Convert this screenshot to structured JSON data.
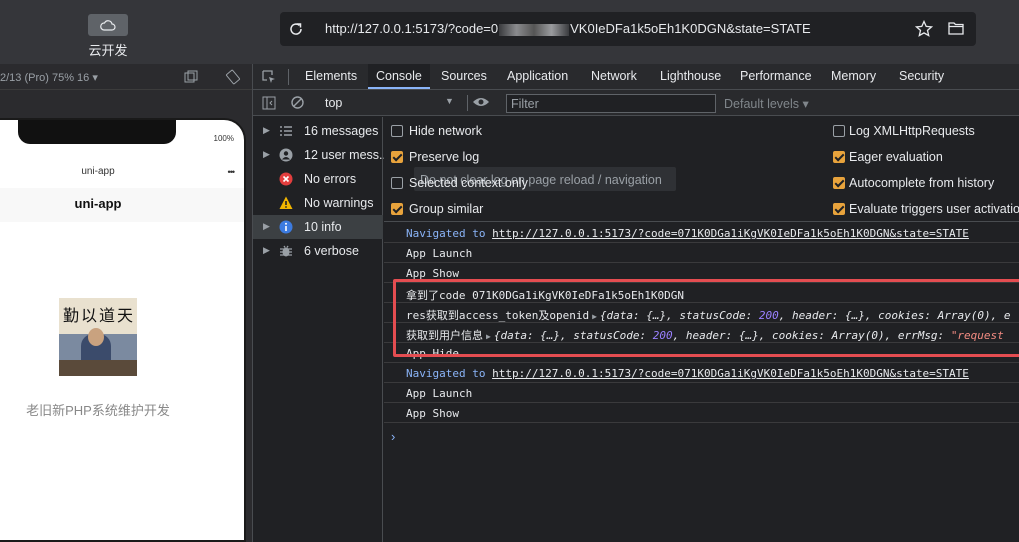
{
  "topbar": {
    "cloud_label": "云开发",
    "url_prefix": "http://127.0.0.1:5173/?code=0",
    "url_suffix": "VK0IeDFa1k5oEh1K0DGN&state=STATE"
  },
  "device": {
    "label": "2/13 (Pro) 75% 16 ▾",
    "battery": "100%",
    "status_title": "uni-app",
    "nav_title": "uni-app",
    "avatar_calligraphy": "勤以道天",
    "caption": "老旧新PHP系统维护开发"
  },
  "devtools": {
    "tabs": [
      "Elements",
      "Console",
      "Sources",
      "Application",
      "Network",
      "Lighthouse",
      "Performance",
      "Memory",
      "Security"
    ],
    "active_tab": "Console",
    "toolbar": {
      "context": "top",
      "filter_placeholder": "Filter",
      "levels": "Default levels ▾"
    },
    "sidebar": [
      {
        "label": "16 messages",
        "icon": "list-icon",
        "color": "#9aa0a6"
      },
      {
        "label": "12 user mess...",
        "icon": "user-icon",
        "color": "#9aa0a6"
      },
      {
        "label": "No errors",
        "icon": "error-icon",
        "color": "#e33e3e"
      },
      {
        "label": "No warnings",
        "icon": "warning-icon",
        "color": "#f2b600"
      },
      {
        "label": "10 info",
        "icon": "info-icon",
        "color": "#3c7be0"
      },
      {
        "label": "6 verbose",
        "icon": "bug-icon",
        "color": "#9aa0a6"
      }
    ],
    "settings": {
      "left": [
        {
          "label": "Hide network",
          "checked": false
        },
        {
          "label": "Preserve log",
          "checked": true
        },
        {
          "label": "Selected context only",
          "checked": false
        },
        {
          "label": "Group similar",
          "checked": true
        }
      ],
      "right": [
        {
          "label": "Log XMLHttpRequests",
          "checked": false
        },
        {
          "label": "Eager evaluation",
          "checked": true
        },
        {
          "label": "Autocomplete from history",
          "checked": true
        },
        {
          "label": "Evaluate triggers user activation",
          "checked": true
        }
      ],
      "tooltip": "Do not clear log on page reload / navigation"
    },
    "log": {
      "nav1_prefix": "Navigated to ",
      "nav1_url": "http://127.0.0.1:5173/?code=071K0DGa1iKgVK0IeDFa1k5oEh1K0DGN&state=STATE",
      "line1": "App Launch",
      "line2": "App Show",
      "code_line": "拿到了code 071K0DGa1iKgVK0IeDFa1k5oEh1K0DGN",
      "res_label": "res获取到access_token及openid",
      "res_obj_a": "{data: {…}, statusCode: ",
      "res_num": "200",
      "res_obj_b": ", header: {…}, cookies: Array(0), e",
      "user_label": "获取到用户信息",
      "user_obj_a": "{data: {…}, statusCode: ",
      "user_num": "200",
      "user_obj_b": ", header: {…}, cookies: Array(0), errMsg: ",
      "user_str": "\"request",
      "hide_line": "App Hide",
      "nav2_prefix": "Navigated to ",
      "nav2_url": "http://127.0.0.1:5173/?code=071K0DGa1iKgVK0IeDFa1k5oEh1K0DGN&state=STATE",
      "line3": "App Launch",
      "line4": "App Show",
      "prompt": "›"
    }
  }
}
